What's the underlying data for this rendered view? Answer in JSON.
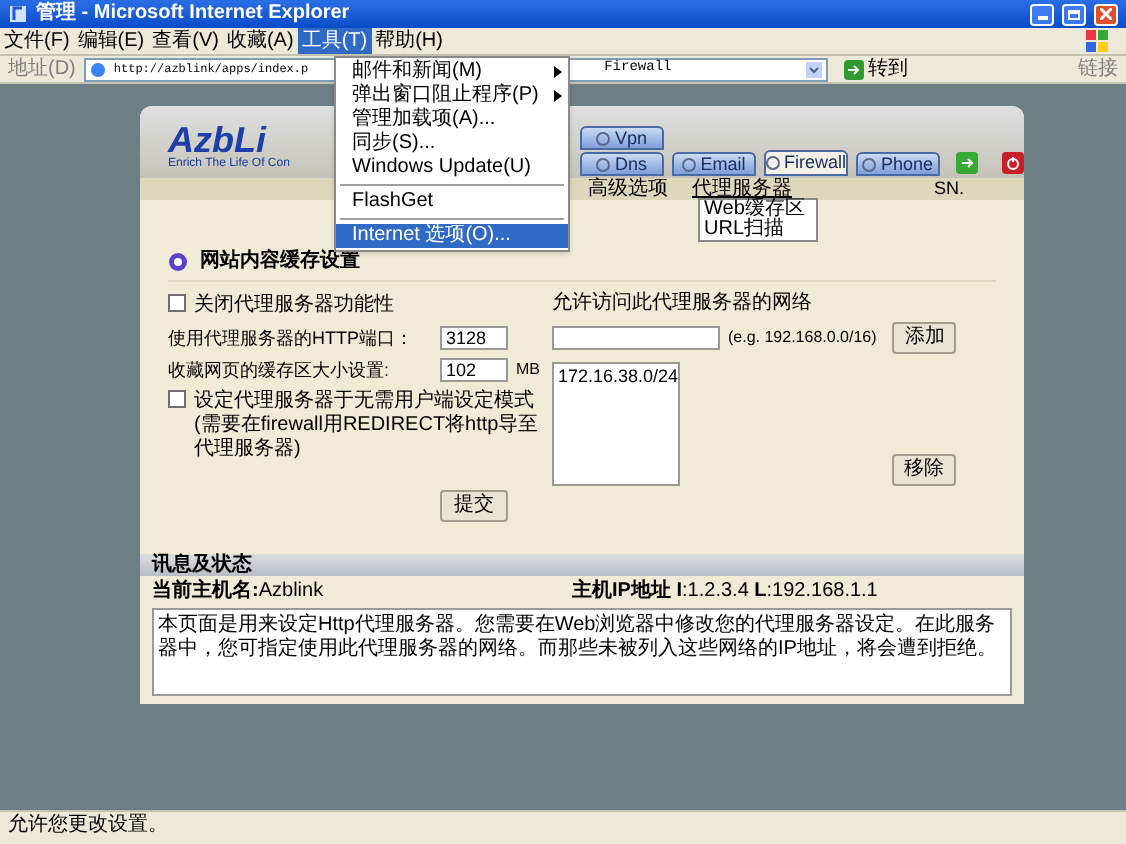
{
  "window": {
    "title": "管理 - Microsoft Internet Explorer"
  },
  "menu_bar": [
    {
      "label": "文件(F)",
      "selected": false
    },
    {
      "label": "编辑(E)",
      "selected": false
    },
    {
      "label": "查看(V)",
      "selected": false
    },
    {
      "label": "收藏(A)",
      "selected": false
    },
    {
      "label": "工具(T)",
      "selected": true
    },
    {
      "label": "帮助(H)",
      "selected": false
    }
  ],
  "tools_menu": [
    {
      "kind": "item",
      "label": "邮件和新闻(M)",
      "submenu": true,
      "selected": false
    },
    {
      "kind": "item",
      "label": "弹出窗口阻止程序(P)",
      "submenu": true,
      "selected": false
    },
    {
      "kind": "item",
      "label": "管理加载项(A)...",
      "submenu": false,
      "selected": false
    },
    {
      "kind": "item",
      "label": "同步(S)...",
      "submenu": false,
      "selected": false
    },
    {
      "kind": "item",
      "label": "Windows Update(U)",
      "submenu": false,
      "selected": false
    },
    {
      "kind": "separator"
    },
    {
      "kind": "item",
      "label": "FlashGet",
      "submenu": false,
      "selected": false
    },
    {
      "kind": "separator"
    },
    {
      "kind": "item",
      "label": "Internet 选项(O)...",
      "submenu": false,
      "selected": true
    }
  ],
  "address_bar": {
    "label": "地址(D)",
    "url_start": "http://azblink/apps/index.p",
    "url_end": "Firewall",
    "go": "转到",
    "links": "链接"
  },
  "page": {
    "logo": "AzbLi",
    "tagline": "Enrich The Life Of Con",
    "tabs": [
      {
        "label": "Vpn",
        "selected": false
      },
      {
        "label": "Dns",
        "selected": false
      },
      {
        "label": "Email",
        "selected": false
      },
      {
        "label": "Firewall",
        "selected": true
      },
      {
        "label": "Phone",
        "selected": false
      }
    ],
    "subnav": [
      {
        "label": "高级选项",
        "expanded": false
      },
      {
        "label": "代理服务器",
        "expanded": true
      }
    ],
    "sn": "SN.",
    "proxy_menu": [
      "Web缓存区",
      "URL扫描"
    ],
    "section_title": "网站内容缓存设置",
    "settings": [
      {
        "kind": "checkbox",
        "label": "关闭代理服务器功能性",
        "checked": false
      },
      {
        "kind": "field",
        "label": "使用代理服务器的HTTP端口：",
        "value": "3128"
      },
      {
        "kind": "field",
        "label": "收藏网页的缓存区大小设置:",
        "value": "102",
        "unit": "MB"
      },
      {
        "kind": "checkbox",
        "label": "设定代理服务器于无需用户端设定模式(需要在firewall用REDIRECT将http导至代理服务器)",
        "checked": false
      }
    ],
    "submit": "提交",
    "network_label": "允许访问此代理服务器的网络",
    "network_hint": "(e.g. 192.168.0.0/16)",
    "add": "添加",
    "networks": [
      "172.16.38.0/24"
    ],
    "remove": "移除",
    "info_title": "讯息及状态",
    "host_label": "当前主机名:",
    "host_value": "Azblink",
    "ip_label": "主机IP地址",
    "ip_i": "I",
    "ip_i_value": ":1.2.3.4",
    "ip_l": "L",
    "ip_l_value": ":192.168.1.1",
    "description": "本页面是用来设定Http代理服务器。您需要在Web浏览器中修改您的代理服务器设定。在此服务器中，您可指定使用此代理服务器的网络。而那些未被列入这些网络的IP地址，将会遭到拒绝。"
  },
  "status_bar": {
    "text": "允许您更改设置。"
  }
}
